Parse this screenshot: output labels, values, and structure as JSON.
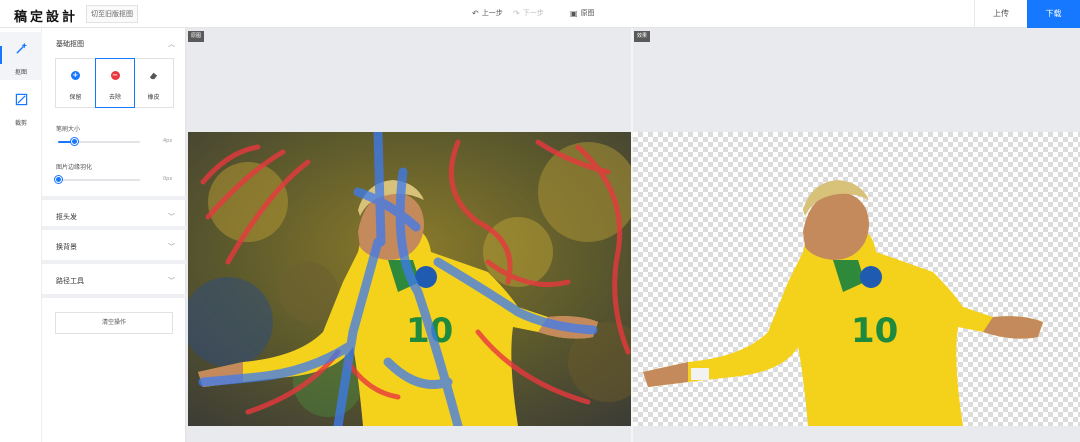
{
  "header": {
    "logo": "稿定設計",
    "old_version_button": "切至旧版抠图",
    "undo_label": "上一步",
    "redo_label": "下一步",
    "original_label": "原图",
    "upload_label": "上传",
    "download_label": "下载"
  },
  "rail": {
    "items": [
      {
        "label": "抠图",
        "icon": "magic-wand-icon",
        "active": true
      },
      {
        "label": "裁剪",
        "icon": "crop-icon",
        "active": false
      }
    ]
  },
  "panel": {
    "basic_section_title": "基础抠图",
    "modes": [
      {
        "label": "保留",
        "icon": "plus-circle-icon",
        "color": "#1677ff"
      },
      {
        "label": "去除",
        "icon": "minus-circle-icon",
        "color": "#e8383d",
        "active": true
      },
      {
        "label": "橡皮",
        "icon": "eraser-icon",
        "color": "#555555"
      }
    ],
    "brush_size_label": "笔刷大小",
    "brush_size_value": "4px",
    "brush_size_level": 0.2,
    "feather_label": "图片边缘羽化",
    "feather_value": "0px",
    "feather_level": 0,
    "hair_section_title": "抠头发",
    "background_section_title": "换背景",
    "path_section_title": "路径工具",
    "clear_button": "清空操作"
  },
  "canvas": {
    "left_tag": "原图",
    "right_tag": "效果"
  },
  "colors": {
    "accent": "#1677ff",
    "remove_stroke": "#e8383d",
    "keep_stroke": "#3d7bf0"
  }
}
